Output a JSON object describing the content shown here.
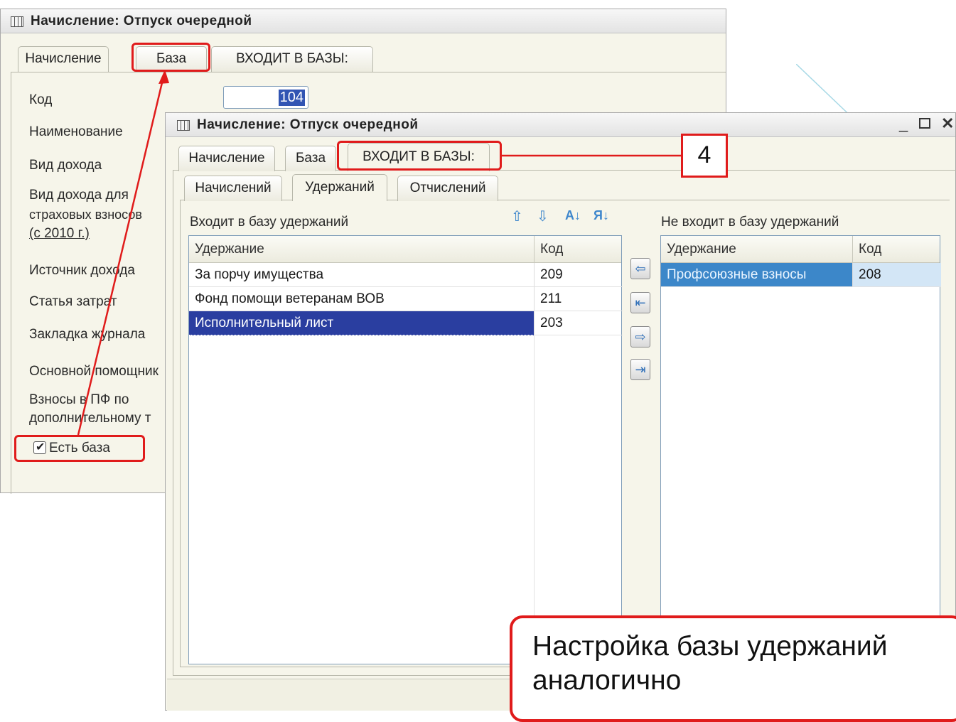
{
  "back_window": {
    "title": "Начисление: Отпуск очередной",
    "tabs": [
      "Начисление",
      "База",
      "ВХОДИТ В БАЗЫ:"
    ],
    "fields": {
      "kod_label": "Код",
      "kod_value": "104",
      "naimenovanie": "Наименование",
      "vid_dohoda": "Вид дохода",
      "vid_dohoda_strah_1": "Вид дохода для",
      "vid_dohoda_strah_2": "страховых взносов",
      "vid_dohoda_strah_3": "(с 2010 г.)",
      "istochnik": "Источник дохода",
      "statya": "Статья затрат",
      "zakladka": "Закладка журнала",
      "osnovnoy": "Основной помощник",
      "vznosy_1": "Взносы в ПФ по",
      "vznosy_2": "дополнительному т",
      "est_baza": "Есть база"
    }
  },
  "front_window": {
    "title": "Начисление: Отпуск очередной",
    "tabs": [
      "Начисление",
      "База",
      "ВХОДИТ В БАЗЫ:"
    ],
    "subtabs": [
      "Начислений",
      "Удержаний",
      "Отчислений"
    ],
    "left": {
      "caption": "Входит в базу удержаний",
      "col_name": "Удержание",
      "col_code": "Код",
      "rows": [
        {
          "name": "За порчу имущества",
          "code": "209"
        },
        {
          "name": "Фонд помощи ветеранам ВОВ",
          "code": "211"
        },
        {
          "name": "Исполнительный лист",
          "code": "203"
        }
      ]
    },
    "right": {
      "caption": "Не входит в базу удержаний",
      "col_name": "Удержание",
      "col_code": "Код",
      "rows": [
        {
          "name": "Профсоюзные взносы",
          "code": "208"
        }
      ]
    },
    "tool_icons": [
      "arrow-up-icon",
      "arrow-down-icon",
      "sort-ascending-icon",
      "sort-descending-icon"
    ],
    "move_buttons": [
      "move-left-icon",
      "move-all-left-icon",
      "move-right-icon",
      "move-all-right-icon"
    ]
  },
  "annotations": {
    "step_number": "4",
    "note": "Настройка базы удержаний аналогично",
    "highlight_color": "#e01b1b"
  }
}
